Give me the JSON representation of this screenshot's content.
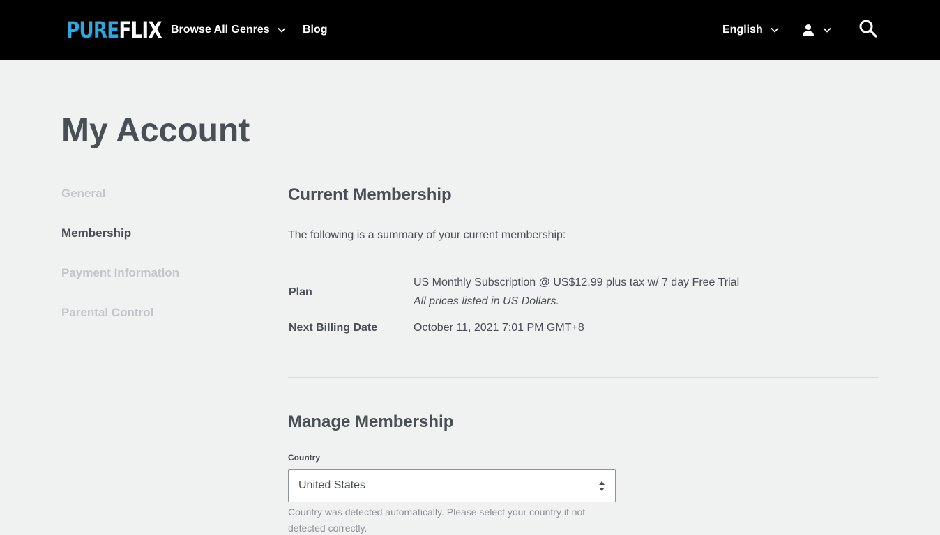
{
  "header": {
    "logo_pure": "PURE",
    "logo_flix": "FLIX",
    "nav": {
      "browse_genres": "Browse All Genres",
      "blog": "Blog",
      "language": "English"
    },
    "icons": {
      "genres_chevron": "chevron-down-icon",
      "language_chevron": "chevron-down-icon",
      "user": "user-icon",
      "user_chevron": "chevron-down-icon",
      "search": "search-icon"
    }
  },
  "page": {
    "title": "My Account"
  },
  "sidebar": {
    "items": [
      {
        "label": "General",
        "active": false
      },
      {
        "label": "Membership",
        "active": true
      },
      {
        "label": "Payment Information",
        "active": false
      },
      {
        "label": "Parental Control",
        "active": false
      }
    ]
  },
  "current_membership": {
    "heading": "Current Membership",
    "summary": "The following is a summary of your current membership:",
    "plan_label": "Plan",
    "plan_value": "US Monthly Subscription @ US$12.99 plus tax w/ 7 day Free Trial",
    "plan_note": "All prices listed in US Dollars.",
    "next_billing_label": "Next Billing Date",
    "next_billing_value": "October 11, 2021 7:01 PM GMT+8"
  },
  "manage_membership": {
    "heading": "Manage Membership",
    "country_label": "Country",
    "country_value": "United States",
    "country_help": "Country was detected automatically. Please select your country if not detected correctly."
  },
  "colors": {
    "header_bg": "#000000",
    "logo_accent": "#2ea7e0",
    "page_bg": "#f0f1f1",
    "text": "#4a4f55",
    "inactive_text": "#c2c6c9"
  }
}
